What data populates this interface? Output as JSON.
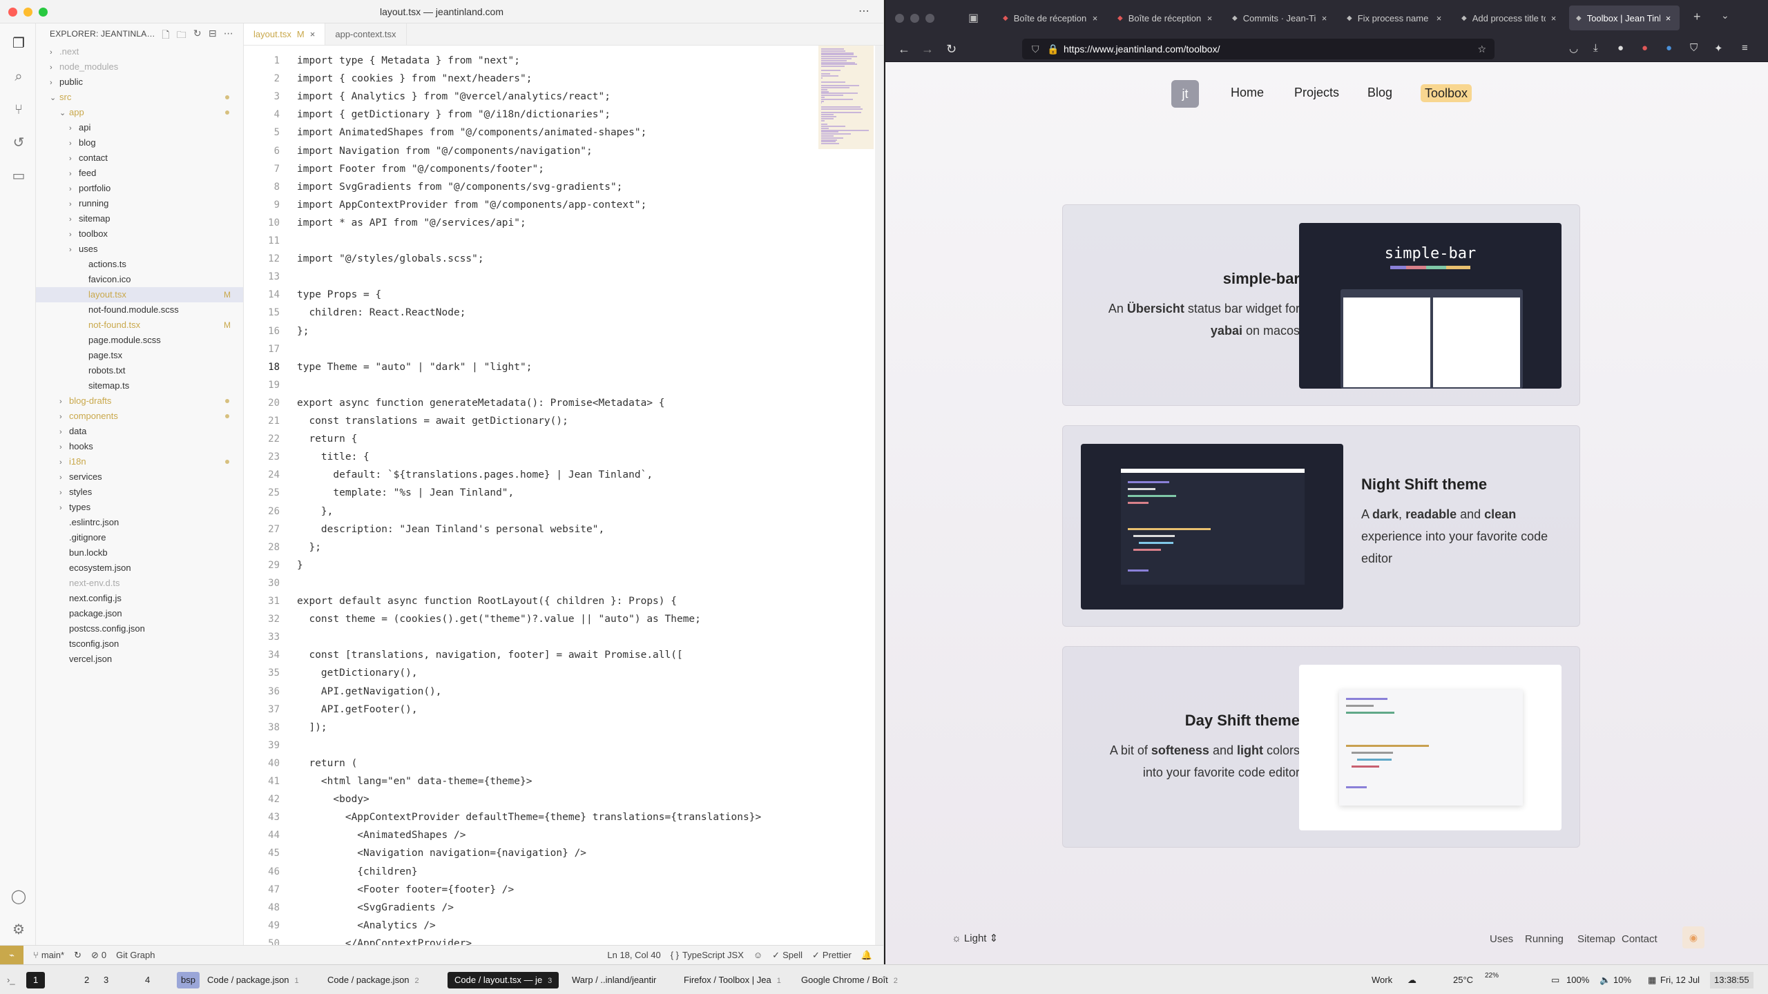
{
  "vscode": {
    "title": "layout.tsx — jeantinland.com",
    "explorer_title": "EXPLORER: JEANTINLA…",
    "tree": [
      {
        "label": ".next",
        "depth": 0,
        "type": "folder",
        "muted": true
      },
      {
        "label": "node_modules",
        "depth": 0,
        "type": "folder",
        "muted": true
      },
      {
        "label": "public",
        "depth": 0,
        "type": "folder"
      },
      {
        "label": "src",
        "depth": 0,
        "type": "folder",
        "open": true,
        "color": "#c9a84b"
      },
      {
        "label": "app",
        "depth": 1,
        "type": "folder",
        "open": true,
        "color": "#c9a84b"
      },
      {
        "label": "api",
        "depth": 2,
        "type": "folder"
      },
      {
        "label": "blog",
        "depth": 2,
        "type": "folder"
      },
      {
        "label": "contact",
        "depth": 2,
        "type": "folder"
      },
      {
        "label": "feed",
        "depth": 2,
        "type": "folder"
      },
      {
        "label": "portfolio",
        "depth": 2,
        "type": "folder"
      },
      {
        "label": "running",
        "depth": 2,
        "type": "folder"
      },
      {
        "label": "sitemap",
        "depth": 2,
        "type": "folder"
      },
      {
        "label": "toolbox",
        "depth": 2,
        "type": "folder"
      },
      {
        "label": "uses",
        "depth": 2,
        "type": "folder"
      },
      {
        "label": "actions.ts",
        "depth": 3,
        "type": "file"
      },
      {
        "label": "favicon.ico",
        "depth": 3,
        "type": "file"
      },
      {
        "label": "layout.tsx",
        "depth": 3,
        "type": "file",
        "selected": true,
        "color": "#c9a84b",
        "mod": "M"
      },
      {
        "label": "not-found.module.scss",
        "depth": 3,
        "type": "file"
      },
      {
        "label": "not-found.tsx",
        "depth": 3,
        "type": "file",
        "color": "#c9a84b",
        "mod": "M"
      },
      {
        "label": "page.module.scss",
        "depth": 3,
        "type": "file"
      },
      {
        "label": "page.tsx",
        "depth": 3,
        "type": "file"
      },
      {
        "label": "robots.txt",
        "depth": 3,
        "type": "file"
      },
      {
        "label": "sitemap.ts",
        "depth": 3,
        "type": "file"
      },
      {
        "label": "blog-drafts",
        "depth": 1,
        "type": "folder",
        "color": "#c9a84b"
      },
      {
        "label": "components",
        "depth": 1,
        "type": "folder",
        "color": "#c9a84b"
      },
      {
        "label": "data",
        "depth": 1,
        "type": "folder"
      },
      {
        "label": "hooks",
        "depth": 1,
        "type": "folder"
      },
      {
        "label": "i18n",
        "depth": 1,
        "type": "folder",
        "color": "#c9a84b"
      },
      {
        "label": "services",
        "depth": 1,
        "type": "folder"
      },
      {
        "label": "styles",
        "depth": 1,
        "type": "folder"
      },
      {
        "label": "types",
        "depth": 1,
        "type": "folder"
      },
      {
        "label": ".eslintrc.json",
        "depth": 1,
        "type": "file"
      },
      {
        "label": ".gitignore",
        "depth": 1,
        "type": "file"
      },
      {
        "label": "bun.lockb",
        "depth": 1,
        "type": "file"
      },
      {
        "label": "ecosystem.json",
        "depth": 1,
        "type": "file"
      },
      {
        "label": "next-env.d.ts",
        "depth": 1,
        "type": "file",
        "muted": true
      },
      {
        "label": "next.config.js",
        "depth": 1,
        "type": "file"
      },
      {
        "label": "package.json",
        "depth": 1,
        "type": "file"
      },
      {
        "label": "postcss.config.json",
        "depth": 1,
        "type": "file"
      },
      {
        "label": "tsconfig.json",
        "depth": 1,
        "type": "file"
      },
      {
        "label": "vercel.json",
        "depth": 1,
        "type": "file"
      }
    ],
    "tabs": [
      {
        "label": "layout.tsx",
        "mod": "M",
        "active": true
      },
      {
        "label": "app-context.tsx",
        "mod": "",
        "active": false
      }
    ],
    "current_line": 18,
    "code": [
      "import type { Metadata } from \"next\";",
      "import { cookies } from \"next/headers\";",
      "import { Analytics } from \"@vercel/analytics/react\";",
      "import { getDictionary } from \"@/i18n/dictionaries\";",
      "import AnimatedShapes from \"@/components/animated-shapes\";",
      "import Navigation from \"@/components/navigation\";",
      "import Footer from \"@/components/footer\";",
      "import SvgGradients from \"@/components/svg-gradients\";",
      "import AppContextProvider from \"@/components/app-context\";",
      "import * as API from \"@/services/api\";",
      "",
      "import \"@/styles/globals.scss\";",
      "",
      "type Props = {",
      "  children: React.ReactNode;",
      "};",
      "",
      "type Theme = \"auto\" | \"dark\" | \"light\";",
      "",
      "export async function generateMetadata(): Promise<Metadata> {",
      "  const translations = await getDictionary();",
      "  return {",
      "    title: {",
      "      default: `${translations.pages.home} | Jean Tinland`,",
      "      template: \"%s | Jean Tinland\",",
      "    },",
      "    description: \"Jean Tinland's personal website\",",
      "  };",
      "}",
      "",
      "export default async function RootLayout({ children }: Props) {",
      "  const theme = (cookies().get(\"theme\")?.value || \"auto\") as Theme;",
      "",
      "  const [translations, navigation, footer] = await Promise.all([",
      "    getDictionary(),",
      "    API.getNavigation(),",
      "    API.getFooter(),",
      "  ]);",
      "",
      "  return (",
      "    <html lang=\"en\" data-theme={theme}>",
      "      <body>",
      "        <AppContextProvider defaultTheme={theme} translations={translations}>",
      "          <AnimatedShapes />",
      "          <Navigation navigation={navigation} />",
      "          {children}",
      "          <Footer footer={footer} />",
      "          <SvgGradients />",
      "          <Analytics />",
      "        </AppContextProvider>"
    ],
    "status": {
      "branch": "main*",
      "ports": "0",
      "git_graph": "Git Graph",
      "position": "Ln 18, Col 40",
      "language": "TypeScript JSX",
      "spell": "Spell",
      "prettier": "Prettier",
      "braces": "{ }"
    }
  },
  "firefox": {
    "tabs": [
      {
        "label": "Boîte de réception -"
      },
      {
        "label": "Boîte de réception ("
      },
      {
        "label": "Commits · Jean-Tinl"
      },
      {
        "label": "Fix process name - J"
      },
      {
        "label": "Add process title to"
      },
      {
        "label": "Toolbox | Jean Tinla",
        "active": true
      }
    ],
    "url": "https://www.jeantinland.com/toolbox/",
    "logo": "jt",
    "nav": [
      "Home",
      "Projects",
      "Blog",
      "Toolbox"
    ],
    "active_nav": "Toolbox",
    "cards": [
      {
        "title": "simple-bar",
        "desc_parts": [
          "An ",
          "Übersicht",
          " status bar widget for ",
          "yabai",
          " on macos"
        ],
        "thumb_label": "simple-bar"
      },
      {
        "title": "Night Shift theme",
        "desc_parts": [
          "A ",
          "dark",
          ", ",
          "readable",
          " and ",
          "clean",
          " experience into your favorite code editor"
        ]
      },
      {
        "title": "Day Shift theme",
        "desc_parts": [
          "A bit of ",
          "softeness",
          " and ",
          "light",
          " colors into your favorite code editor"
        ]
      }
    ],
    "theme_select": "Light",
    "footer_links": [
      "Uses",
      "Running",
      "Sitemap",
      "Contact"
    ]
  },
  "dock": {
    "spaces": [
      "1",
      "2",
      "3",
      "4"
    ],
    "bsp": "bsp",
    "windows": [
      {
        "label": "Code / package.json",
        "count": "1"
      },
      {
        "label": "Code / package.json",
        "count": "2"
      },
      {
        "label": "Code / layout.tsx — je",
        "count": "3",
        "active": true
      },
      {
        "label": "Warp / ..inland/jeantir",
        "count": ""
      },
      {
        "label": "Firefox / Toolbox | Jea",
        "count": "1"
      },
      {
        "label": "Google Chrome / Boît",
        "count": "2"
      }
    ],
    "work": "Work",
    "temp": "25°C",
    "cpu": "22%",
    "battery": "100%",
    "volume": "10%",
    "date": "Fri, 12 Jul",
    "time": "13:38:55"
  }
}
